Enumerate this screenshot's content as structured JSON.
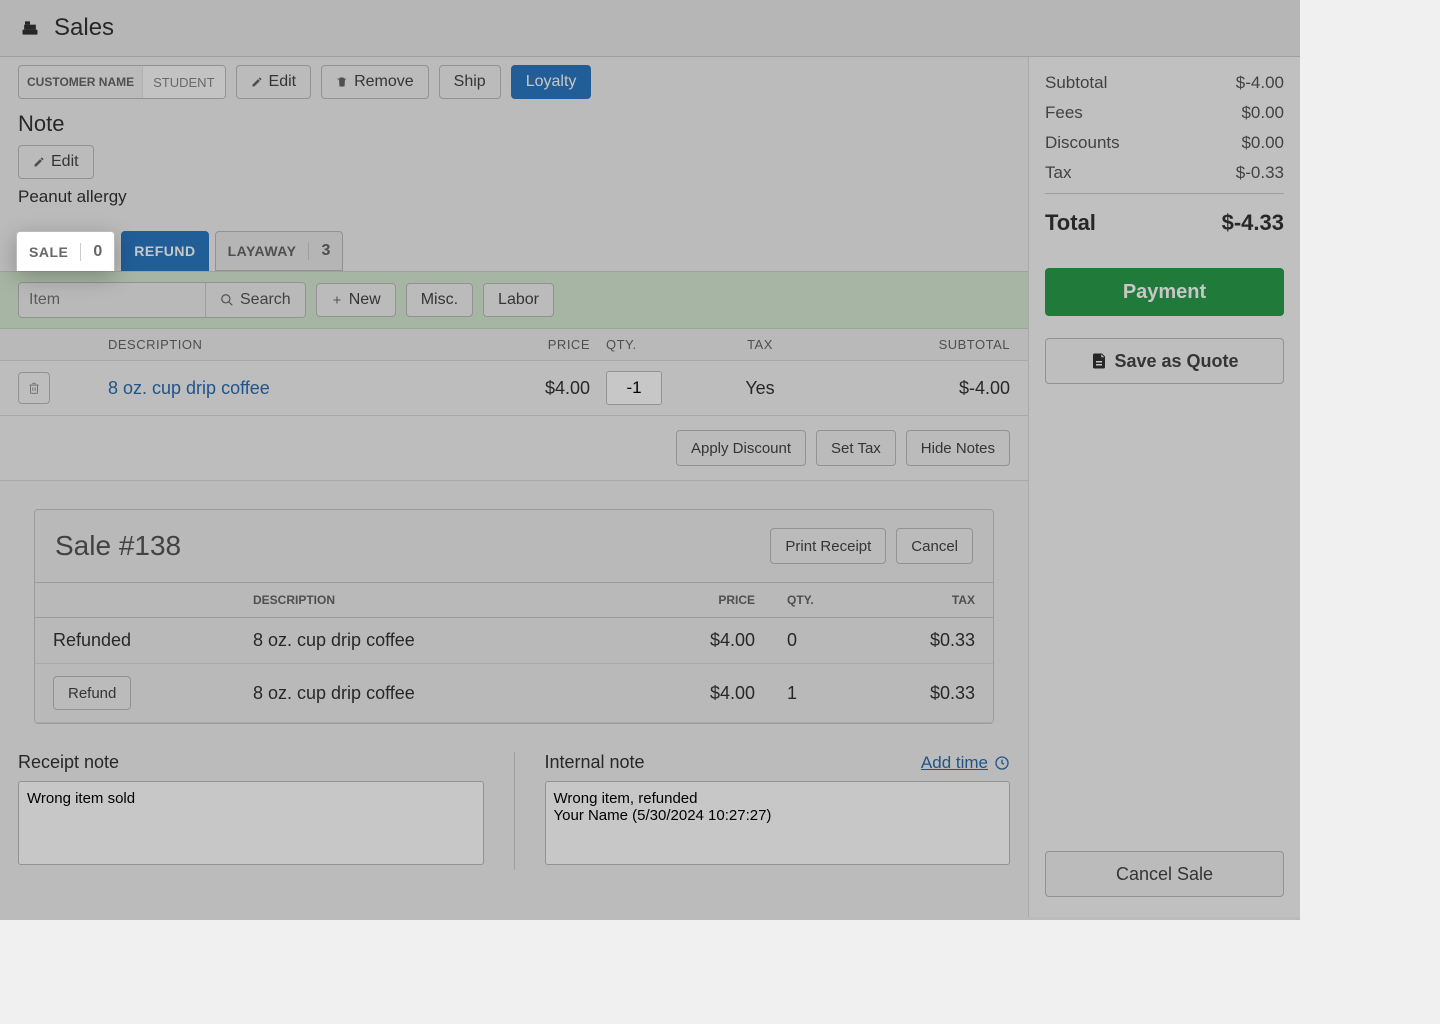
{
  "header": {
    "title": "Sales"
  },
  "customer": {
    "label": "CUSTOMER NAME",
    "value": "STUDENT"
  },
  "actions": {
    "edit": "Edit",
    "remove": "Remove",
    "ship": "Ship",
    "loyalty": "Loyalty"
  },
  "note": {
    "heading": "Note",
    "edit": "Edit",
    "text": "Peanut allergy"
  },
  "tabs": {
    "sale": {
      "label": "SALE",
      "count": "0"
    },
    "refund": {
      "label": "REFUND"
    },
    "layaway": {
      "label": "LAYAWAY",
      "count": "3"
    }
  },
  "search": {
    "placeholder": "Item",
    "button": "Search",
    "new": "New",
    "misc": "Misc.",
    "labor": "Labor"
  },
  "columns": {
    "desc": "DESCRIPTION",
    "price": "PRICE",
    "qty": "QTY.",
    "tax": "TAX",
    "subtotal": "SUBTOTAL"
  },
  "lines": [
    {
      "desc": "8 oz. cup drip coffee",
      "price": "$4.00",
      "qty": "-1",
      "tax": "Yes",
      "subtotal": "$-4.00"
    }
  ],
  "lineactions": {
    "discount": "Apply Discount",
    "settax": "Set Tax",
    "hidenotes": "Hide Notes"
  },
  "sale": {
    "title_prefix": "Sale #",
    "number": "138",
    "print": "Print Receipt",
    "cancel": "Cancel",
    "cols": {
      "desc": "DESCRIPTION",
      "price": "PRICE",
      "qty": "QTY.",
      "tax": "TAX"
    },
    "rows": [
      {
        "status": "Refunded",
        "desc": "8 oz. cup drip coffee",
        "price": "$4.00",
        "qty": "0",
        "tax": "$0.33"
      },
      {
        "status_btn": "Refund",
        "desc": "8 oz. cup drip coffee",
        "price": "$4.00",
        "qty": "1",
        "tax": "$0.33"
      }
    ]
  },
  "notes": {
    "receipt_label": "Receipt note",
    "receipt_text": "Wrong item sold",
    "internal_label": "Internal note",
    "addtime": "Add time",
    "internal_text": "Wrong item, refunded\nYour Name (5/30/2024 10:27:27)"
  },
  "summary": {
    "subtotal_label": "Subtotal",
    "subtotal": "$-4.00",
    "fees_label": "Fees",
    "fees": "$0.00",
    "discounts_label": "Discounts",
    "discounts": "$0.00",
    "tax_label": "Tax",
    "tax": "$-0.33",
    "total_label": "Total",
    "total": "$-4.33"
  },
  "right_actions": {
    "payment": "Payment",
    "save_quote": "Save as Quote",
    "cancel_sale": "Cancel Sale"
  }
}
